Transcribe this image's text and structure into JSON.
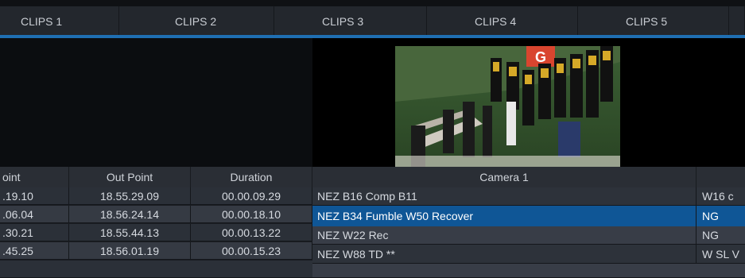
{
  "tabs": [
    "CLIPS 1",
    "CLIPS 2",
    "CLIPS 3",
    "CLIPS 4",
    "CLIPS 5"
  ],
  "columns": {
    "in_point": "oint",
    "out_point": "Out Point",
    "duration": "Duration",
    "camera": "Camera 1"
  },
  "clips_left": [
    {
      "in": ".19.10",
      "out": "18.55.29.09",
      "dur": "00.00.09.29"
    },
    {
      "in": ".06.04",
      "out": "18.56.24.14",
      "dur": "00.00.18.10"
    },
    {
      "in": ".30.21",
      "out": "18.55.44.13",
      "dur": "00.00.13.22"
    },
    {
      "in": ".45.25",
      "out": "18.56.01.19",
      "dur": "00.00.15.23"
    }
  ],
  "clips_right": [
    {
      "name": "NEZ B16 Comp B11",
      "note": "W16 c"
    },
    {
      "name": "NEZ B34 Fumble W50 Recover",
      "note": "NG",
      "selected": true
    },
    {
      "name": "NEZ W22 Rec",
      "note": "NG"
    },
    {
      "name": "NEZ W88 TD **",
      "note": "W SL V"
    }
  ],
  "colors": {
    "accent": "#1f6fb3",
    "selected_row": "#0f5696",
    "background": "#1a1d22"
  }
}
